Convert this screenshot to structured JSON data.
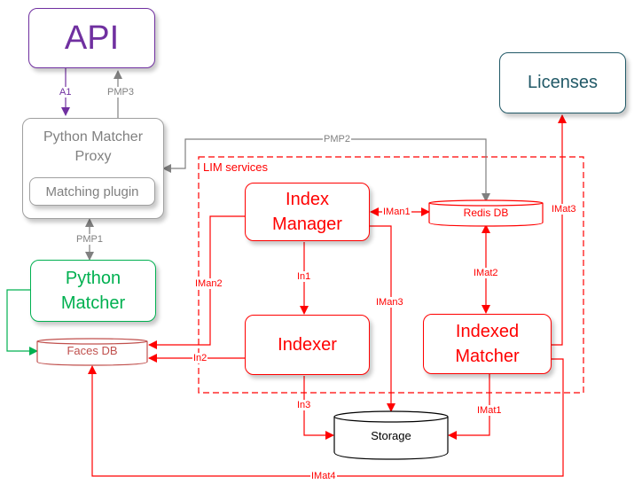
{
  "colors": {
    "api": "#7030a0",
    "proxy": "#808080",
    "python_matcher": "#00b050",
    "lim": "#ff0000",
    "faces_db": "#c0504d",
    "licenses": "#215967",
    "storage": "#000000"
  },
  "nodes": {
    "api": "API",
    "proxy": "Python Matcher Proxy",
    "matching_plugin": "Matching plugin",
    "python_matcher": "Python Matcher",
    "faces_db": "Faces DB",
    "lim_group": "LIM services",
    "index_manager": "Index Manager",
    "redis_db": "Redis DB",
    "indexer": "Indexer",
    "indexed_matcher": "Indexed Matcher",
    "storage": "Storage",
    "licenses": "Licenses"
  },
  "edges": {
    "a1": "A1",
    "pmp3": "PMP3",
    "pmp2": "PMP2",
    "pmp1": "PMP1",
    "iman1": "IMan1",
    "iman2": "IMan2",
    "iman3": "IMan3",
    "in1": "In1",
    "in2": "In2",
    "in3": "In3",
    "imat1": "IMat1",
    "imat2": "IMat2",
    "imat3": "IMat3",
    "imat4": "IMat4"
  }
}
